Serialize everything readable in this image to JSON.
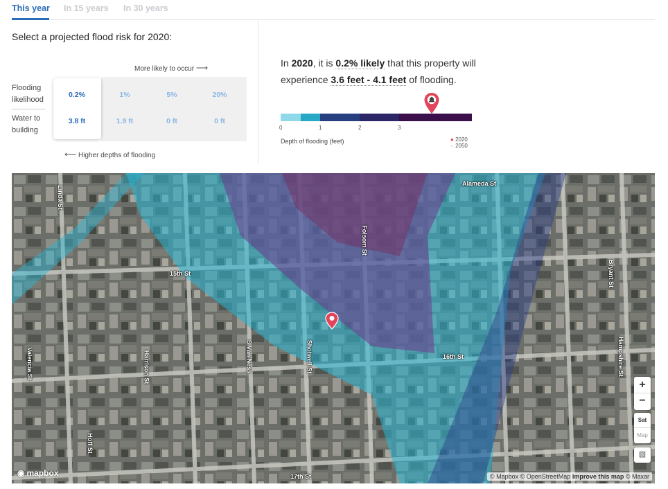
{
  "tabs": [
    {
      "label": "This year",
      "active": true
    },
    {
      "label": "In 15 years",
      "active": false
    },
    {
      "label": "In 30 years",
      "active": false
    }
  ],
  "selector": {
    "title": "Select a projected flood risk for 2020:",
    "more_likely": "More likely to occur",
    "higher_depths": "Higher depths of flooding",
    "row_labels": [
      "Flooding likelihood",
      "Water to building"
    ],
    "columns": [
      {
        "likelihood": "0.2%",
        "water": "3.8 ft",
        "selected": true
      },
      {
        "likelihood": "1%",
        "water": "1.9 ft",
        "selected": false
      },
      {
        "likelihood": "5%",
        "water": "0 ft",
        "selected": false
      },
      {
        "likelihood": "20%",
        "water": "0 ft",
        "selected": false
      }
    ]
  },
  "summary": {
    "prefix": "In",
    "year": "2020",
    "mid": ", it is",
    "likelihood": "0.2% likely",
    "mid2": "that this property will experience",
    "depth_range": "3.6 feet - 4.1 feet",
    "suffix": "of flooding."
  },
  "legend": {
    "ticks": [
      "0",
      "1",
      "2",
      "3"
    ],
    "depth_label": "Depth of flooding (feet)",
    "year_a": "2020",
    "year_b": "2050",
    "colors": [
      "#8fd9ea",
      "#27a8c4",
      "#273f7e",
      "#2b1a5e",
      "#3a0f4c"
    ],
    "pin_color": "#e2445c"
  },
  "map": {
    "streets": [
      "15th St",
      "16th St",
      "17th St",
      "Folsom St",
      "Shotwell St",
      "S Van Ness",
      "Harrison St",
      "Bryant St",
      "Alameda St",
      "Hampshire St",
      "Valencia St",
      "Hoff St",
      "Linda St"
    ],
    "zoom_in": "+",
    "zoom_out": "−",
    "sat_label": "Sat",
    "map_label": "Map",
    "logo": "mapbox",
    "attribution": {
      "a": "© Mapbox © OpenStreetMap",
      "improve": "Improve this map",
      "b": "© Maxar"
    }
  }
}
